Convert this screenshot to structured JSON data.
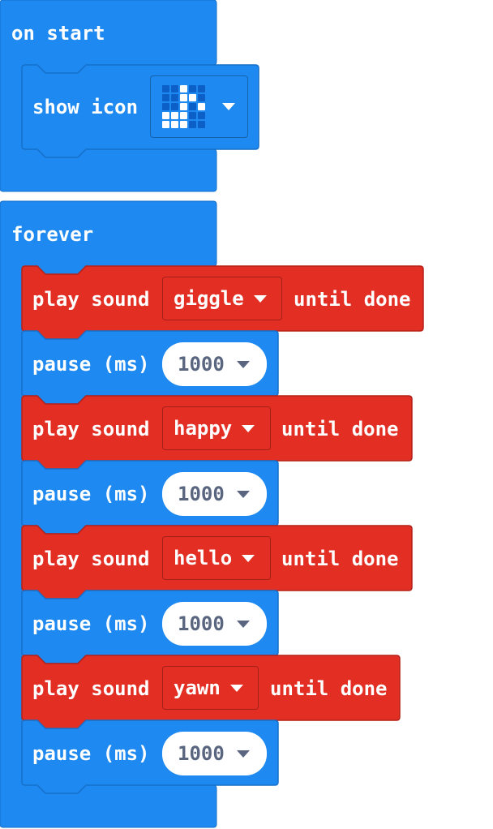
{
  "blocks": {
    "on_start": {
      "label": "on start",
      "show_icon": {
        "label": "show icon",
        "icon_grid": [
          [
            0,
            0,
            1,
            0,
            0
          ],
          [
            0,
            0,
            1,
            1,
            0
          ],
          [
            0,
            0,
            1,
            0,
            1
          ],
          [
            1,
            1,
            1,
            0,
            0
          ],
          [
            1,
            1,
            1,
            0,
            0
          ]
        ]
      }
    },
    "forever": {
      "label": "forever",
      "statements": [
        {
          "type": "play_sound",
          "prefix": "play sound",
          "sound": "giggle",
          "suffix": "until done"
        },
        {
          "type": "pause",
          "label": "pause (ms)",
          "value": "1000"
        },
        {
          "type": "play_sound",
          "prefix": "play sound",
          "sound": "happy",
          "suffix": "until done"
        },
        {
          "type": "pause",
          "label": "pause (ms)",
          "value": "1000"
        },
        {
          "type": "play_sound",
          "prefix": "play sound",
          "sound": "hello",
          "suffix": "until done"
        },
        {
          "type": "pause",
          "label": "pause (ms)",
          "value": "1000"
        },
        {
          "type": "play_sound",
          "prefix": "play sound",
          "sound": "yawn",
          "suffix": "until done"
        },
        {
          "type": "pause",
          "label": "pause (ms)",
          "value": "1000"
        }
      ]
    }
  },
  "colors": {
    "basic_blue": "#1e89f0",
    "block_outline": "#1670c9",
    "music_red": "#e32e23",
    "music_outline": "#b52019",
    "led_off": "#0c5fc6",
    "led_on": "#ffffff",
    "value_text": "#5a6680"
  }
}
